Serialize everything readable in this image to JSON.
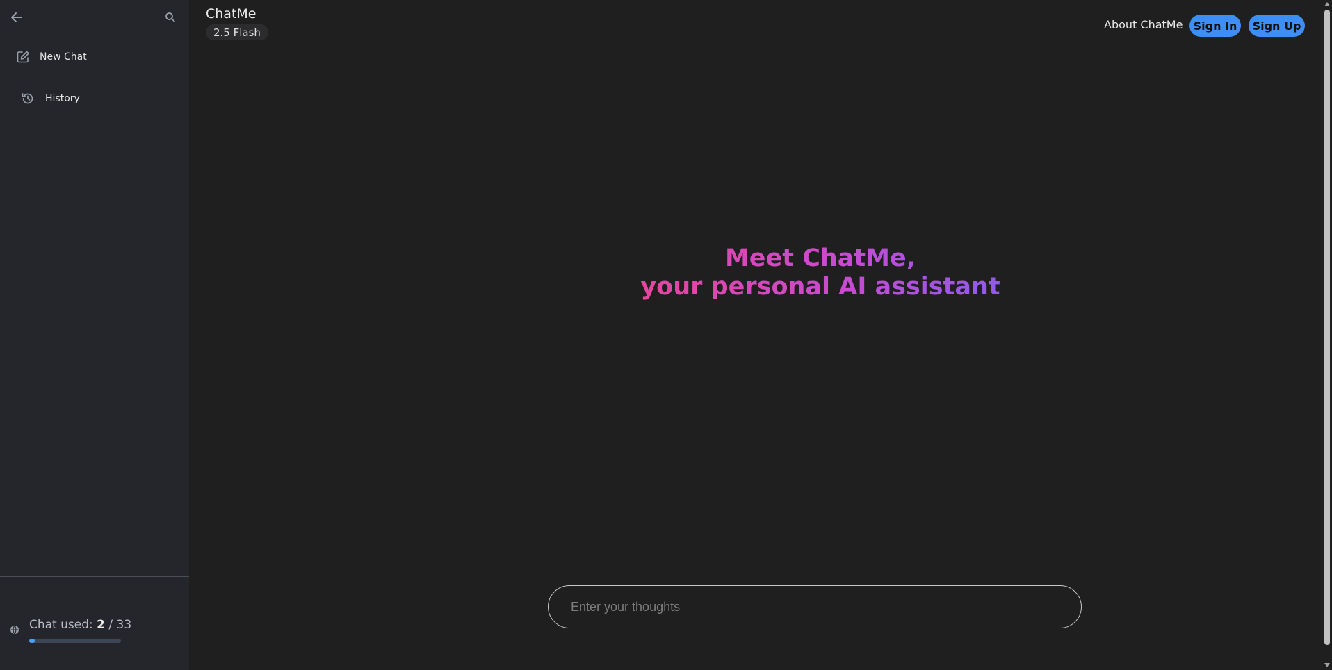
{
  "sidebar": {
    "back_icon": "arrow-left-icon",
    "search_icon": "search-icon",
    "items": [
      {
        "label": "New Chat",
        "icon": "edit-icon"
      },
      {
        "label": "History",
        "icon": "history-icon"
      }
    ],
    "usage": {
      "label": "Chat used: ",
      "used": "2",
      "separator": " / ",
      "total": "33",
      "fraction": 0.0606
    }
  },
  "header": {
    "title": "ChatMe",
    "model": "2.5 Flash",
    "about": "About ChatMe",
    "sign_in": "Sign In",
    "sign_up": "Sign Up"
  },
  "hero": {
    "line1": "Meet ChatMe,",
    "line2": "your personal AI assistant"
  },
  "composer": {
    "placeholder": "Enter your thoughts",
    "value": ""
  },
  "colors": {
    "accent": "#3e8ef7",
    "gradient_start": "#e8459a",
    "gradient_end": "#8a5cf0",
    "background": "#1f1f20",
    "sidebar": "#24262b"
  }
}
